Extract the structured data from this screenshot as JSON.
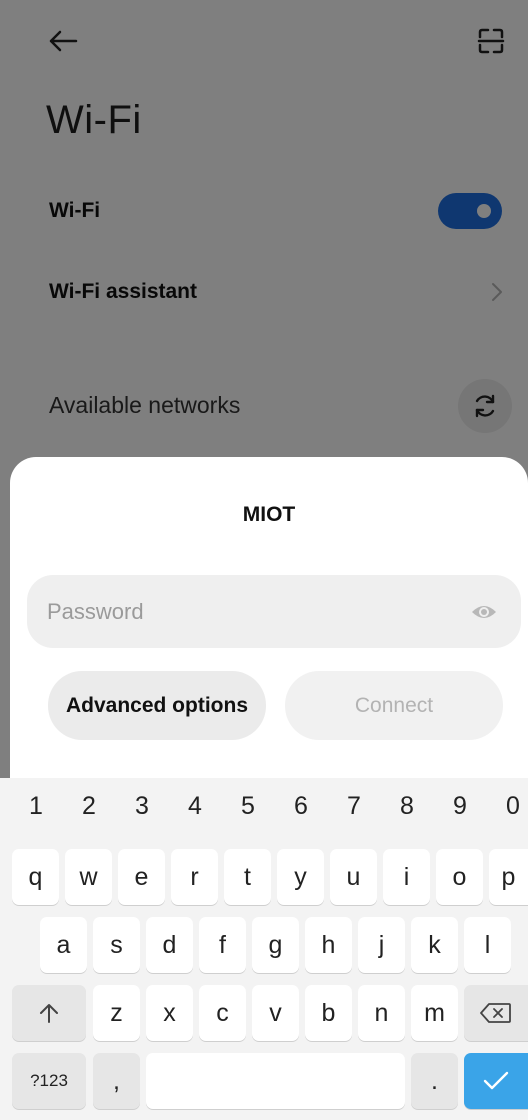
{
  "header": {
    "back_icon": "arrow-left-icon",
    "scan_icon": "scan-frame-icon",
    "title": "Wi-Fi"
  },
  "settings": {
    "wifi_label": "Wi-Fi",
    "wifi_enabled": true,
    "wifi_assistant_label": "Wi-Fi assistant",
    "available_networks_label": "Available networks",
    "refresh_icon": "refresh-icon"
  },
  "dialog": {
    "network_name": "MIOT",
    "password": {
      "placeholder": "Password",
      "value": ""
    },
    "show_password_icon": "eye-icon",
    "advanced_label": "Advanced options",
    "connect_label": "Connect"
  },
  "keyboard": {
    "number_row": [
      "1",
      "2",
      "3",
      "4",
      "5",
      "6",
      "7",
      "8",
      "9",
      "0"
    ],
    "row1": [
      "q",
      "w",
      "e",
      "r",
      "t",
      "y",
      "u",
      "i",
      "o",
      "p"
    ],
    "row2": [
      "a",
      "s",
      "d",
      "f",
      "g",
      "h",
      "j",
      "k",
      "l"
    ],
    "row3": [
      "z",
      "x",
      "c",
      "v",
      "b",
      "n",
      "m"
    ],
    "symbols_label": "?123",
    "comma": ",",
    "period": ".",
    "shift_icon": "shift-arrow-icon",
    "backspace_icon": "backspace-icon",
    "enter_icon": "checkmark-icon"
  },
  "colors": {
    "accent": "#1f6fe0",
    "enter_key": "#3aa4e8"
  }
}
